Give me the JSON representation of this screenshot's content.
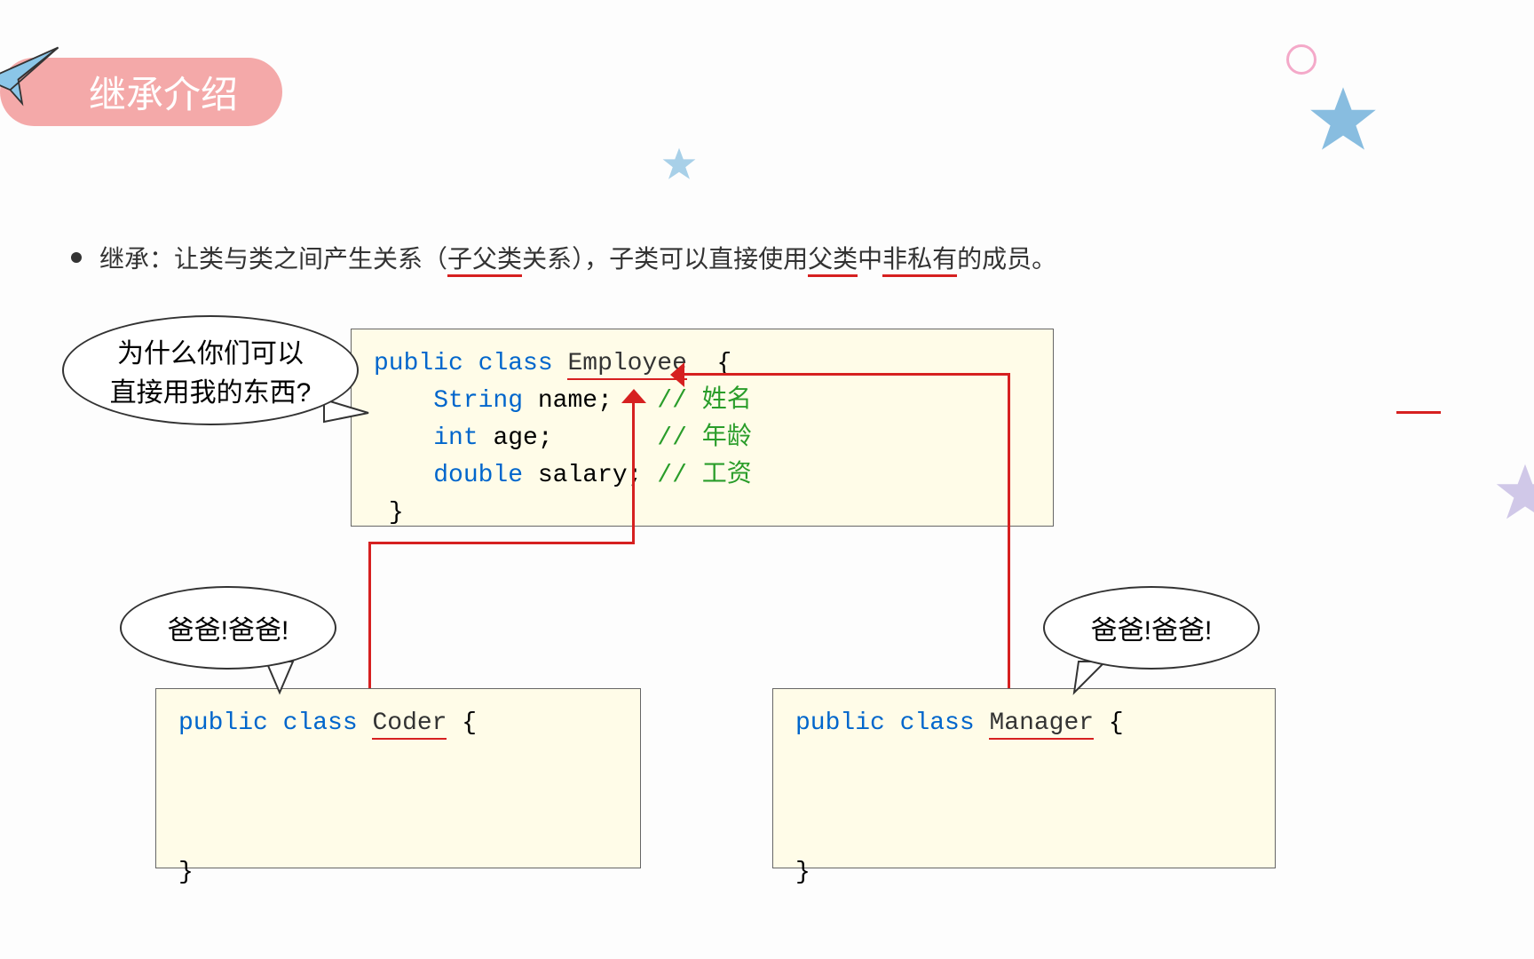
{
  "title": "继承介绍",
  "bullet": {
    "pre1": "继承：让",
    "red1": "类与类之间产生关系",
    "paren_open": "（",
    "teal1": "子父类",
    "paren_rest": "关系），",
    "teal2": "子类",
    "mid1": "可以",
    "teal3": "直接使用",
    "teal4": "父类",
    "mid2": "中",
    "teal5": "非私有",
    "end": "的成员。"
  },
  "bubbles": {
    "employee": "为什么你们可以\n直接用我的东西?",
    "coder": "爸爸!爸爸!",
    "manager": "爸爸!爸爸!"
  },
  "code": {
    "employee": {
      "public": "public",
      "class": "class",
      "name": "Employee",
      "brace_open": "{",
      "field1_type": "String",
      "field1_name": "name;",
      "field1_comment": "// 姓名",
      "field2_type": "int",
      "field2_name": "age;",
      "field2_comment": "// 年龄",
      "field3_type": "double",
      "field3_name": "salary;",
      "field3_comment": "// 工资",
      "brace_close": "}"
    },
    "coder": {
      "public": "public",
      "class": "class",
      "name": "Coder",
      "brace_open": "{",
      "brace_close": "}"
    },
    "manager": {
      "public": "public",
      "class": "class",
      "name": "Manager",
      "brace_open": "{",
      "brace_close": "}"
    }
  }
}
